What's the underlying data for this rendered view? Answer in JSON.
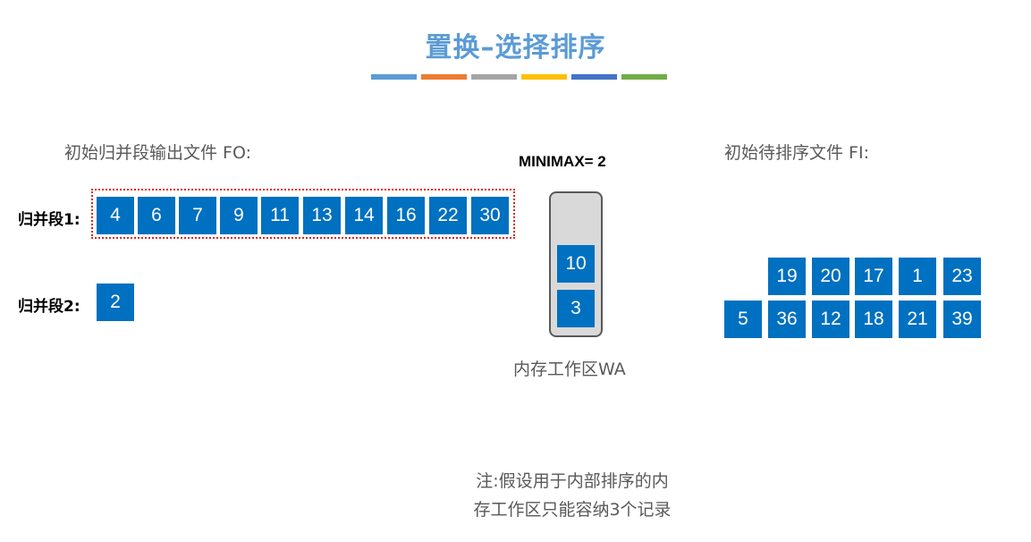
{
  "title": "置换–选择排序",
  "colorbar": [
    "#5B9BD5",
    "#ED7D31",
    "#A5A5A5",
    "#FFC000",
    "#4472C4",
    "#70AD47"
  ],
  "fo": {
    "label": "初始归并段输出文件 FO:",
    "segment1": {
      "label": "归并段1:",
      "values": [
        "4",
        "6",
        "7",
        "9",
        "11",
        "13",
        "14",
        "16",
        "22",
        "30"
      ]
    },
    "segment2": {
      "label": "归并段2:",
      "values": [
        "2"
      ]
    }
  },
  "minimax": "MINIMAX= 2",
  "workarea": {
    "label": "内存工作区WA",
    "values": [
      "10",
      "3"
    ]
  },
  "fi": {
    "label": "初始待排序文件 FI:",
    "row1": [
      "19",
      "20",
      "17",
      "1",
      "23"
    ],
    "row2": [
      "5",
      "36",
      "12",
      "18",
      "21",
      "39"
    ]
  },
  "note": {
    "line1": "注:假设用于内部排序的内",
    "line2": "存工作区只能容纳3个记录"
  }
}
